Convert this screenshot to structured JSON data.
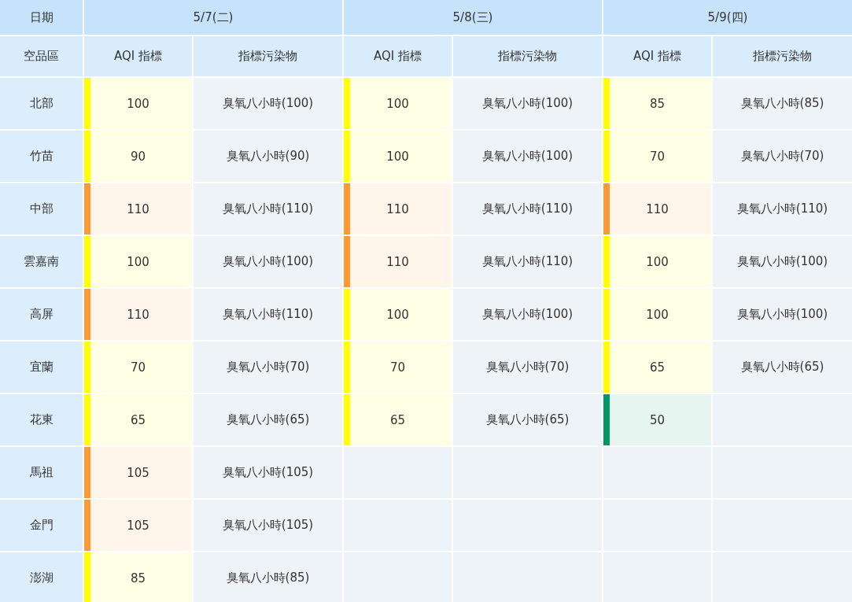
{
  "table": {
    "corner_top": "日期",
    "dates": [
      "5/7(二)",
      "5/8(三)",
      "5/9(四)"
    ],
    "corner_bottom": "空品區",
    "subheaders": [
      "AQI 指標",
      "指標污染物",
      "AQI 指標",
      "指標污染物",
      "AQI 指標",
      "指標污染物"
    ],
    "rows": [
      {
        "region": "北部",
        "days": [
          {
            "aqi": "100",
            "color": "#ffff00",
            "pollutant": "臭氧八小時(100)"
          },
          {
            "aqi": "100",
            "color": "#ffff00",
            "pollutant": "臭氧八小時(100)"
          },
          {
            "aqi": "85",
            "color": "#ffff00",
            "pollutant": "臭氧八小時(85)"
          }
        ]
      },
      {
        "region": "竹苗",
        "days": [
          {
            "aqi": "90",
            "color": "#ffff00",
            "pollutant": "臭氧八小時(90)"
          },
          {
            "aqi": "100",
            "color": "#ffff00",
            "pollutant": "臭氧八小時(100)"
          },
          {
            "aqi": "70",
            "color": "#ffff00",
            "pollutant": "臭氧八小時(70)"
          }
        ]
      },
      {
        "region": "中部",
        "days": [
          {
            "aqi": "110",
            "color": "#ff9933",
            "pollutant": "臭氧八小時(110)"
          },
          {
            "aqi": "110",
            "color": "#ff9933",
            "pollutant": "臭氧八小時(110)"
          },
          {
            "aqi": "110",
            "color": "#ff9933",
            "pollutant": "臭氧八小時(110)"
          }
        ]
      },
      {
        "region": "雲嘉南",
        "days": [
          {
            "aqi": "100",
            "color": "#ffff00",
            "pollutant": "臭氧八小時(100)"
          },
          {
            "aqi": "110",
            "color": "#ff9933",
            "pollutant": "臭氧八小時(110)"
          },
          {
            "aqi": "100",
            "color": "#ffff00",
            "pollutant": "臭氧八小時(100)"
          }
        ]
      },
      {
        "region": "高屏",
        "days": [
          {
            "aqi": "110",
            "color": "#ff9933",
            "pollutant": "臭氧八小時(110)"
          },
          {
            "aqi": "100",
            "color": "#ffff00",
            "pollutant": "臭氧八小時(100)"
          },
          {
            "aqi": "100",
            "color": "#ffff00",
            "pollutant": "臭氧八小時(100)"
          }
        ]
      },
      {
        "region": "宜蘭",
        "days": [
          {
            "aqi": "70",
            "color": "#ffff00",
            "pollutant": "臭氧八小時(70)"
          },
          {
            "aqi": "70",
            "color": "#ffff00",
            "pollutant": "臭氧八小時(70)"
          },
          {
            "aqi": "65",
            "color": "#ffff00",
            "pollutant": "臭氧八小時(65)"
          }
        ]
      },
      {
        "region": "花東",
        "days": [
          {
            "aqi": "65",
            "color": "#ffff00",
            "pollutant": "臭氧八小時(65)"
          },
          {
            "aqi": "65",
            "color": "#ffff00",
            "pollutant": "臭氧八小時(65)"
          },
          {
            "aqi": "50",
            "color": "#009865"
          }
        ]
      },
      {
        "region": "馬祖",
        "days": [
          {
            "aqi": "105",
            "color": "#ff9933",
            "pollutant": "臭氧八小時(105)"
          }
        ]
      },
      {
        "region": "金門",
        "days": [
          {
            "aqi": "105",
            "color": "#ff9933",
            "pollutant": "臭氧八小時(105)"
          }
        ]
      },
      {
        "region": "澎湖",
        "days": [
          {
            "aqi": "85",
            "color": "#ffff00",
            "pollutant": "臭氧八小時(85)"
          }
        ]
      }
    ]
  }
}
